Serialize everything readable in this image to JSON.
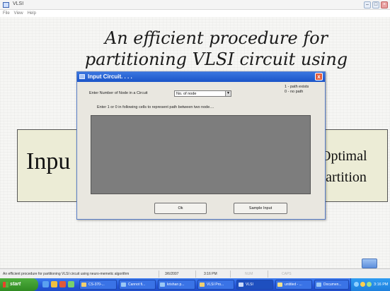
{
  "app": {
    "title": "VLSI",
    "menu": [
      "File",
      "View",
      "Help"
    ]
  },
  "slide": {
    "title_line1": "An efficient procedure for",
    "title_line2": "partitioning VLSI circuit using",
    "input_box": "Inpu",
    "output_line1": "Optimal",
    "output_line2": "Partition"
  },
  "dialog": {
    "title": "Input Circuit. . . .",
    "close_label": "x",
    "node_prompt": "Enter Number of Node in a Circuit",
    "node_select_value": "No. of node",
    "legend_line1": "1 - path exists",
    "legend_line2": "0 - no path",
    "matrix_prompt": "Enter 1 or 0 in following cells to represent path between two node....",
    "ok_label": "Ok",
    "sample_label": "Sample Input"
  },
  "statusbar": {
    "description": "An efficient procedure for partitioning VLSI circuit using neuro-memetic algorithm",
    "date": "3/6/2007",
    "time": "3:16 PM",
    "num": "NUM",
    "caps": "CAPS"
  },
  "taskbar": {
    "start_label": "start",
    "tasks": [
      "CS-370-...",
      "Cannot fi...",
      "krishan p...",
      "VLSI Pro...",
      "VLSI",
      "untitled - ...",
      "Documen..."
    ],
    "clock": "3:16 PM"
  },
  "colors": {
    "dialog_title_bar": "#2a64d8",
    "matrix_area": "#7d7d7d",
    "slide_box": "#ececd6",
    "taskbar": "#2455d6",
    "start_button": "#3a9a2c"
  }
}
